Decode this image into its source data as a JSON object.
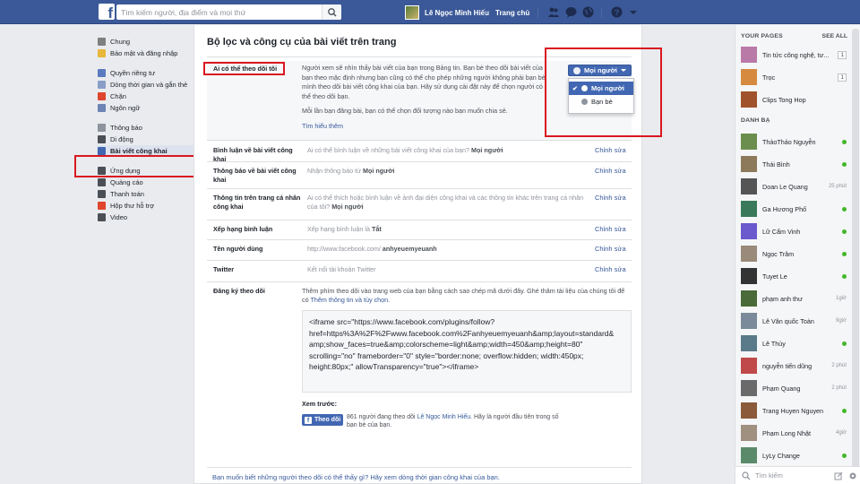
{
  "topbar": {
    "search_placeholder": "Tìm kiếm người, địa điểm và mọi thứ",
    "user_name": "Lê Ngọc Minh Hiếu",
    "home_label": "Trang chủ"
  },
  "sidebar": {
    "items": [
      {
        "label": "Chung",
        "color": "#7f7f7f"
      },
      {
        "label": "Bảo mật và đăng nhập",
        "color": "#e8b73b"
      },
      {
        "label": "Quyền riêng tư",
        "color": "#5b7bc0"
      },
      {
        "label": "Dòng thời gian và gắn thẻ",
        "color": "#8a9fc8"
      },
      {
        "label": "Chặn",
        "color": "#e0452e"
      },
      {
        "label": "Ngôn ngữ",
        "color": "#6d84b4"
      },
      {
        "label": "Thông báo",
        "color": "#8d949e"
      },
      {
        "label": "Di động",
        "color": "#4b4f56"
      },
      {
        "label": "Bài viết công khai",
        "color": "#4267b2"
      },
      {
        "label": "Ứng dụng",
        "color": "#4b4f56"
      },
      {
        "label": "Quảng cáo",
        "color": "#4b4f56"
      },
      {
        "label": "Thanh toán",
        "color": "#4b4f56"
      },
      {
        "label": "Hộp thư hỗ trợ",
        "color": "#e0452e"
      },
      {
        "label": "Video",
        "color": "#4b4f56"
      }
    ]
  },
  "main": {
    "title": "Bộ lọc và công cụ của bài viết trên trang",
    "who_follow": {
      "label": "Ai có thể theo dõi tôi",
      "desc": "Người xem sẽ nhìn thấy bài viết của bạn trong Bảng tin. Bạn bè theo dõi bài viết của bạn theo mặc định nhưng bạn cũng có thể cho phép những người không phải bạn bè mình theo dõi bài viết công khai của bạn. Hãy sử dụng cài đặt này để chọn người có thể theo dõi bạn.",
      "note": "Mỗi lần bạn đăng bài, bạn có thể chọn đối tượng nào bạn muốn chia sẻ.",
      "learn_more": "Tìm hiểu thêm",
      "audience_button": "Mọi người",
      "options": [
        "Mọi người",
        "Bạn bè"
      ]
    },
    "rows": [
      {
        "label": "Bình luận về bài viết công khai",
        "desc": "Ai có thể bình luận về những bài viết công khai của bạn?",
        "value": "Mọi người",
        "edit": "Chỉnh sửa"
      },
      {
        "label": "Thông báo về bài viết công khai",
        "desc": "Nhận thông báo từ",
        "value": "Mọi người",
        "edit": "Chỉnh sửa"
      },
      {
        "label": "Thông tin trên trang cá nhân công khai",
        "desc": "Ai có thể thích hoặc bình luận về ảnh đại diện công khai và các thông tin khác trên trang cá nhân của tôi?",
        "value": "Mọi người",
        "edit": "Chỉnh sửa"
      },
      {
        "label": "Xếp hạng bình luận",
        "desc": "Xếp hạng bình luận là",
        "value": "Tắt",
        "edit": "Chỉnh sửa"
      },
      {
        "label": "Tên người dùng",
        "desc": "http://www.facebook.com/",
        "value": "anhyeuemyeuanh",
        "edit": "Chỉnh sửa"
      },
      {
        "label": "Twitter",
        "desc": "Kết nối tài khoản Twitter",
        "value": "",
        "edit": "Chỉnh sửa"
      }
    ],
    "plugin": {
      "label": "Đăng ký theo dõi",
      "desc": "Thêm phím theo dõi vào trang web của bạn bằng cách sao chép mã dưới đây. Ghé thăm tài liệu của chúng tôi để có",
      "link": "Thêm thông tin và tùy chọn.",
      "code": "<iframe src=\"https://www.facebook.com/plugins/follow?\nhref=https%3A%2F%2Fwww.facebook.com%2Fanhyeuemyeuanh&amp;layout=standard&\namp;show_faces=true&amp;colorscheme=light&amp;width=450&amp;height=80\"\nscrolling=\"no\" frameborder=\"0\" style=\"border:none; overflow:hidden; width:450px;\nheight:80px;\" allowTransparency=\"true\"></iframe>",
      "preview_label": "Xem trước:",
      "follow_button": "Theo dõi",
      "preview_text_1": "861 người đang theo dõi",
      "preview_name": "Lê Ngọc Minh Hiếu",
      "preview_text_2": ". Hãy là người đầu tiên trong số bạn bè của bạn."
    },
    "footer_link": "Bạn muốn biết những người theo dõi có thể thấy gì? Hãy xem dòng thời gian công khai của bạn."
  },
  "right": {
    "pages_header": "YOUR PAGES",
    "see_all": "SEE ALL",
    "pages": [
      {
        "name": "Tin tức công nghệ, tư...",
        "badge": "1",
        "color": "#b97aa8"
      },
      {
        "name": "Trọc",
        "badge": "1",
        "color": "#d68a3f"
      },
      {
        "name": "Clips Tong Hop",
        "badge": "",
        "color": "#a0522d"
      }
    ],
    "friends_header": "DANH BẠ",
    "friends": [
      {
        "name": "ThảoThảo Nguyễn",
        "status": "online",
        "color": "#6b8e4e"
      },
      {
        "name": "Thái Bình",
        "status": "online",
        "color": "#8c7a5a"
      },
      {
        "name": "Doan Le Quang",
        "status": "25 phút",
        "color": "#555"
      },
      {
        "name": "Ga Hương Phố",
        "status": "online",
        "color": "#3a7a5a"
      },
      {
        "name": "Lữ Cẩm Vinh",
        "status": "online",
        "color": "#6a5acd"
      },
      {
        "name": "Ngọc Trâm",
        "status": "online",
        "color": "#9a8a7a"
      },
      {
        "name": "Tuyet Le",
        "status": "online",
        "color": "#333"
      },
      {
        "name": "phạm anh thư",
        "status": "1giờ",
        "color": "#4a6a3a"
      },
      {
        "name": "Lê Văn quốc Toàn",
        "status": "9giờ",
        "color": "#7a8a9a"
      },
      {
        "name": "Lê Thủy",
        "status": "online",
        "color": "#5a7a8a"
      },
      {
        "name": "nguyễn tiến dũng",
        "status": "2 phút",
        "color": "#c04a4a"
      },
      {
        "name": "Phạm Quang",
        "status": "2 phút",
        "color": "#6a6a6a"
      },
      {
        "name": "Trang Huyen Nguyen",
        "status": "online",
        "color": "#8a5a3a"
      },
      {
        "name": "Phạm Long Nhật",
        "status": "4giờ",
        "color": "#a09080"
      },
      {
        "name": "LyLy Change",
        "status": "online",
        "color": "#5a8a6a"
      }
    ],
    "chat_search_placeholder": "Tìm kiếm"
  },
  "colors": {
    "brand": "#3b5998",
    "button": "#4267b2",
    "link": "#365899",
    "highlight_box": "#d9181f",
    "online": "#42b72a"
  }
}
